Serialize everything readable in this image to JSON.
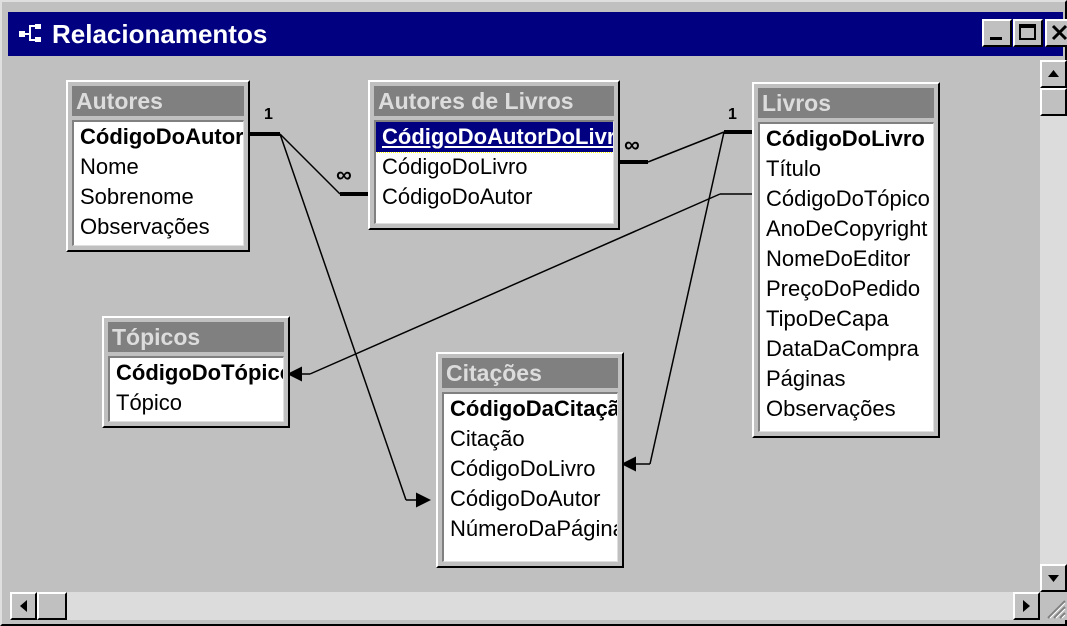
{
  "window": {
    "title": "Relacionamentos"
  },
  "tables": {
    "autores": {
      "name": "Autores",
      "fields": [
        "CódigoDoAutor",
        "Nome",
        "Sobrenome",
        "Observações"
      ]
    },
    "autores_livros": {
      "name": "Autores de Livros",
      "fields": [
        "CódigoDoAutorDoLivro",
        "CódigoDoLivro",
        "CódigoDoAutor"
      ]
    },
    "livros": {
      "name": "Livros",
      "fields": [
        "CódigoDoLivro",
        "Título",
        "CódigoDoTópico",
        "AnoDeCopyright",
        "NomeDoEditor",
        "PreçoDoPedido",
        "TipoDeCapa",
        "DataDaCompra",
        "Páginas",
        "Observações"
      ]
    },
    "topicos": {
      "name": "Tópicos",
      "fields": [
        "CódigoDoTópico",
        "Tópico"
      ]
    },
    "citacoes": {
      "name": "Citações",
      "fields": [
        "CódigoDaCitação",
        "Citação",
        "CódigoDoLivro",
        "CódigoDoAutor",
        "NúmeroDaPágina"
      ]
    }
  },
  "relationships": {
    "one_label": "1",
    "many_label": "∞"
  }
}
